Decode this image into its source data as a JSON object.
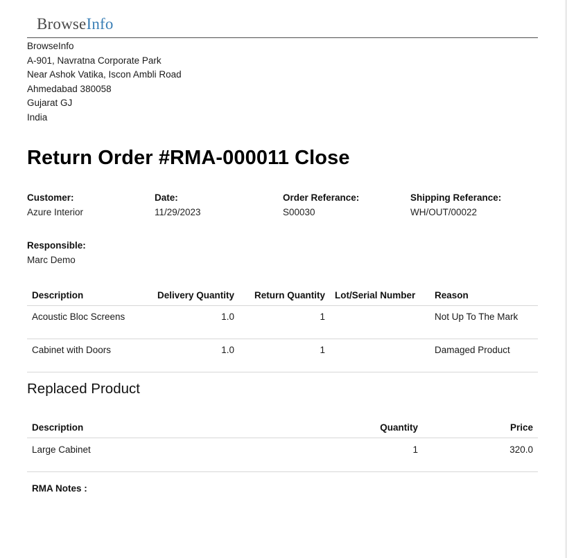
{
  "logo": {
    "part1": "Browse",
    "part2": "Info"
  },
  "company": {
    "name": "BrowseInfo",
    "address_lines": [
      "A-901, Navratna Corporate Park",
      "Near Ashok Vatika, Iscon Ambli Road",
      "Ahmedabad 380058",
      "Gujarat GJ",
      "India"
    ]
  },
  "title": "Return Order #RMA-000011 Close",
  "info": {
    "customer": {
      "label": "Customer:",
      "value": "Azure Interior"
    },
    "date": {
      "label": "Date:",
      "value": "11/29/2023"
    },
    "order_ref": {
      "label": "Order Referance:",
      "value": "S00030"
    },
    "shipping_ref": {
      "label": "Shipping Referance:",
      "value": "WH/OUT/00022"
    },
    "responsible": {
      "label": "Responsible:",
      "value": "Marc Demo"
    }
  },
  "returns_table": {
    "headers": [
      "Description",
      "Delivery Quantity",
      "Return Quantity",
      "Lot/Serial Number",
      "Reason"
    ],
    "rows": [
      [
        "Acoustic Bloc Screens",
        "1.0",
        "1",
        "",
        "Not Up To The Mark"
      ],
      [
        "Cabinet with Doors",
        "1.0",
        "1",
        "",
        "Damaged Product"
      ]
    ]
  },
  "replaced": {
    "title": "Replaced Product",
    "headers": [
      "Description",
      "Quantity",
      "Price"
    ],
    "rows": [
      [
        "Large Cabinet",
        "1",
        "320.0"
      ]
    ]
  },
  "notes_label": "RMA Notes :",
  "colors": {
    "logo_grey": "#4a4a4a",
    "logo_blue": "#3b7fb6",
    "rule": "#4d4d4d",
    "row_border": "#d6d6d6"
  }
}
